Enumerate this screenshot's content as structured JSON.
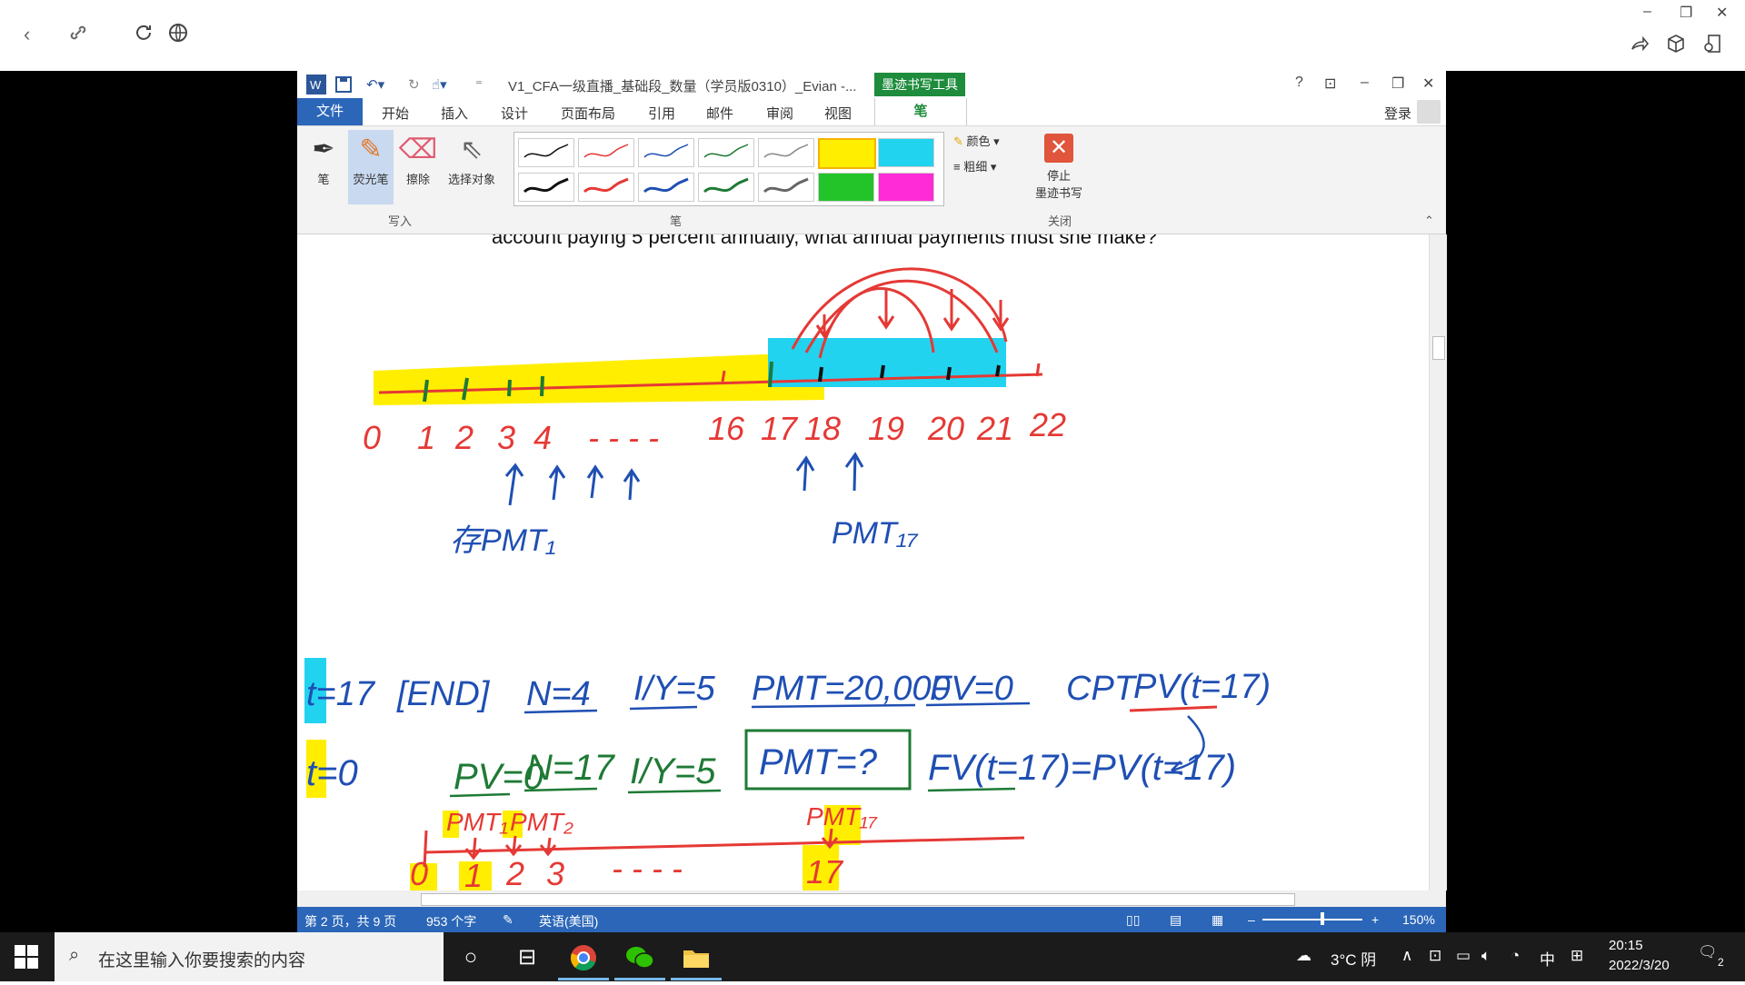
{
  "viewer": {
    "back": "‹",
    "win_min": "–",
    "win_restore": "❐",
    "win_close": "✕"
  },
  "word": {
    "title": "V1_CFA一级直播_基础段_数量（学员版0310）_Evian -...",
    "ink_tools_header": "墨迹书写工具",
    "help": "?",
    "menus": [
      "文件",
      "开始",
      "插入",
      "设计",
      "页面布局",
      "引用",
      "邮件",
      "审阅",
      "视图",
      "笔"
    ],
    "login": "登录",
    "ribbon": {
      "tools": [
        "笔",
        "荧光笔",
        "擦除",
        "选择对象"
      ],
      "group_write": "写入",
      "group_pens": "笔",
      "group_close": "关闭",
      "color": "颜色",
      "thickness": "粗细",
      "stop_label_1": "停止",
      "stop_label_2": "墨迹书写"
    },
    "doc_text": "account paying 5 percent annually, what annual payments must she make?",
    "status": {
      "page": "第 2 页，共 9 页",
      "words": "953 个字",
      "lang": "英语(美国)",
      "zoom": "150%"
    }
  },
  "ink": {
    "timeline1_labels": [
      "0",
      "1",
      "2",
      "3",
      "4",
      "- - - -",
      "16",
      "17",
      "18",
      "19",
      "20",
      "21",
      "22"
    ],
    "pmt1": "存PMT₁",
    "pmt17": "PMT₁₇",
    "row1": [
      "t=17",
      "[END]",
      "N=4",
      "I/Y=5",
      "PMT=20,000",
      "FV=0",
      "CPT",
      "PV(t=17)"
    ],
    "row2": [
      "t=0",
      "PV=0",
      "N=17",
      "I/Y=5",
      "PMT=?",
      "FV(t=17)=PV(t=17)"
    ],
    "timeline2_top": [
      "PMT₁",
      "PMT₂",
      "PMT₁₇"
    ],
    "timeline2_labels": [
      "0",
      "1",
      "2",
      "3",
      "- - - -",
      "17"
    ]
  },
  "taskbar": {
    "search_placeholder": "在这里输入你要搜索的内容",
    "weather": "3°C 阴",
    "ime": "中",
    "time": "20:15",
    "date": "2022/3/20",
    "notifications": "2"
  },
  "colors": {
    "word_blue": "#2b66b8",
    "ink_red": "#e53935",
    "ink_blue": "#1f4fb3",
    "ink_green": "#1e7a35",
    "highlight_yellow": "#ffee00",
    "highlight_cyan": "#22d3f0"
  }
}
